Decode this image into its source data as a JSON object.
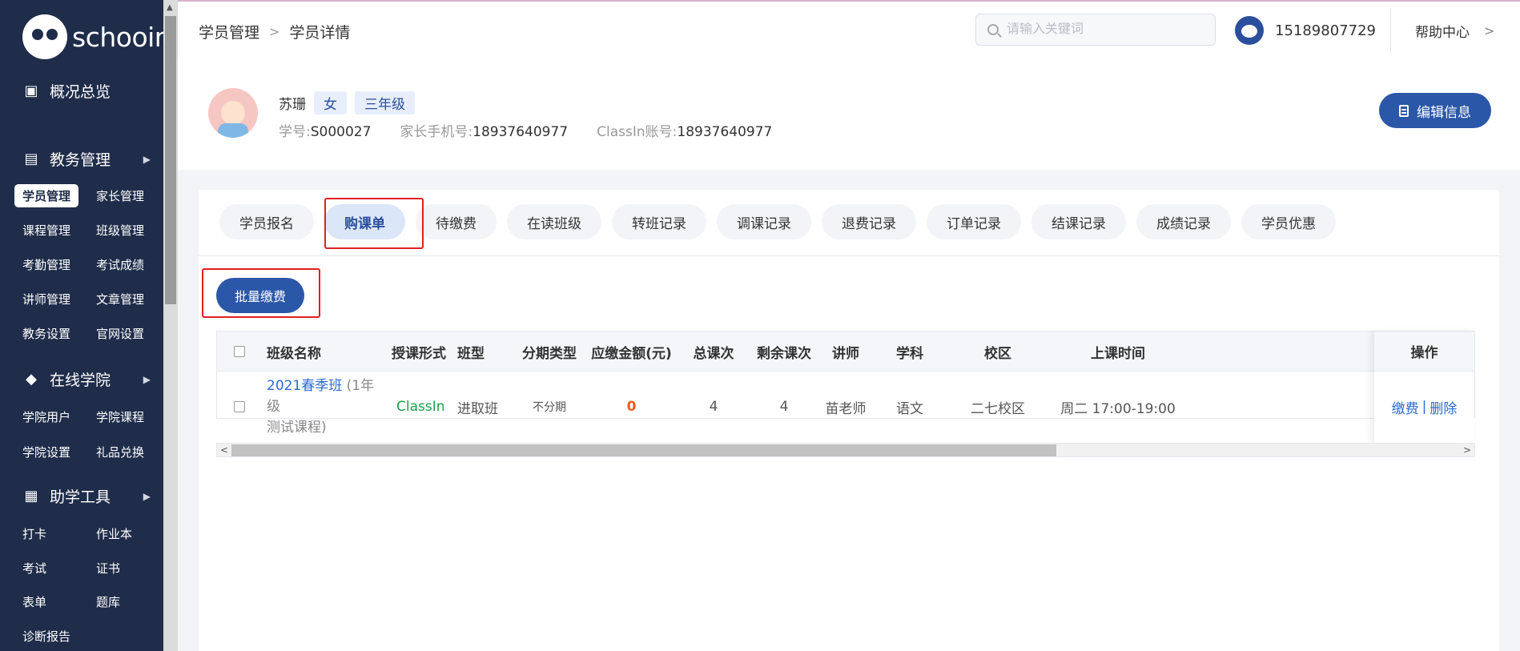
{
  "brand": {
    "name": "schooin"
  },
  "sidebar": {
    "sections": [
      {
        "label": "概况总览",
        "icon": "dashboard-icon"
      },
      {
        "label": "教务管理",
        "icon": "book-icon"
      },
      {
        "label": "在线学院",
        "icon": "graduation-cap-icon"
      },
      {
        "label": "助学工具",
        "icon": "grid-icon"
      }
    ],
    "edu_items": [
      "学员管理",
      "家长管理",
      "课程管理",
      "班级管理",
      "考勤管理",
      "考试成绩",
      "讲师管理",
      "文章管理",
      "教务设置",
      "官网设置"
    ],
    "college_items": [
      "学院用户",
      "学院课程",
      "学院设置",
      "礼品兑换"
    ],
    "tool_items": [
      "打卡",
      "作业本",
      "考试",
      "证书",
      "表单",
      "题库",
      "诊断报告"
    ]
  },
  "header": {
    "breadcrumb": [
      "学员管理",
      "学员详情"
    ],
    "search_placeholder": "请输入关键词",
    "phone": "15189807729",
    "help": "帮助中心"
  },
  "student": {
    "name": "苏珊",
    "gender": "女",
    "grade": "三年级",
    "id_label": "学号:",
    "id": "S000027",
    "parent_label": "家长手机号:",
    "parent_phone": "18937640977",
    "classin_label": "ClassIn账号:",
    "classin": "18937640977",
    "edit_label": "编辑信息"
  },
  "tabs": [
    "学员报名",
    "购课单",
    "待缴费",
    "在读班级",
    "转班记录",
    "调课记录",
    "退费记录",
    "订单记录",
    "结课记录",
    "成绩记录",
    "学员优惠"
  ],
  "active_tab": "购课单",
  "batch_pay": "批量缴费",
  "table": {
    "headers": [
      "班级名称",
      "授课形式",
      "班型",
      "分期类型",
      "应缴金额(元)",
      "总课次",
      "剩余课次",
      "讲师",
      "学科",
      "校区",
      "上课时间",
      "操作"
    ],
    "rows": [
      {
        "class_name": "2021春季班",
        "class_note_1": " (1年级",
        "class_note_2": "测试课程)",
        "mode": "ClassIn",
        "type": "进取班",
        "installment": "不分期",
        "amount": "0",
        "total": "4",
        "remaining": "4",
        "teacher": "苗老师",
        "subject": "语文",
        "campus": "二七校区",
        "time": "周二 17:00-19:00",
        "op_pay": "缴费",
        "op_sep": "|",
        "op_delete": "删除"
      }
    ]
  }
}
